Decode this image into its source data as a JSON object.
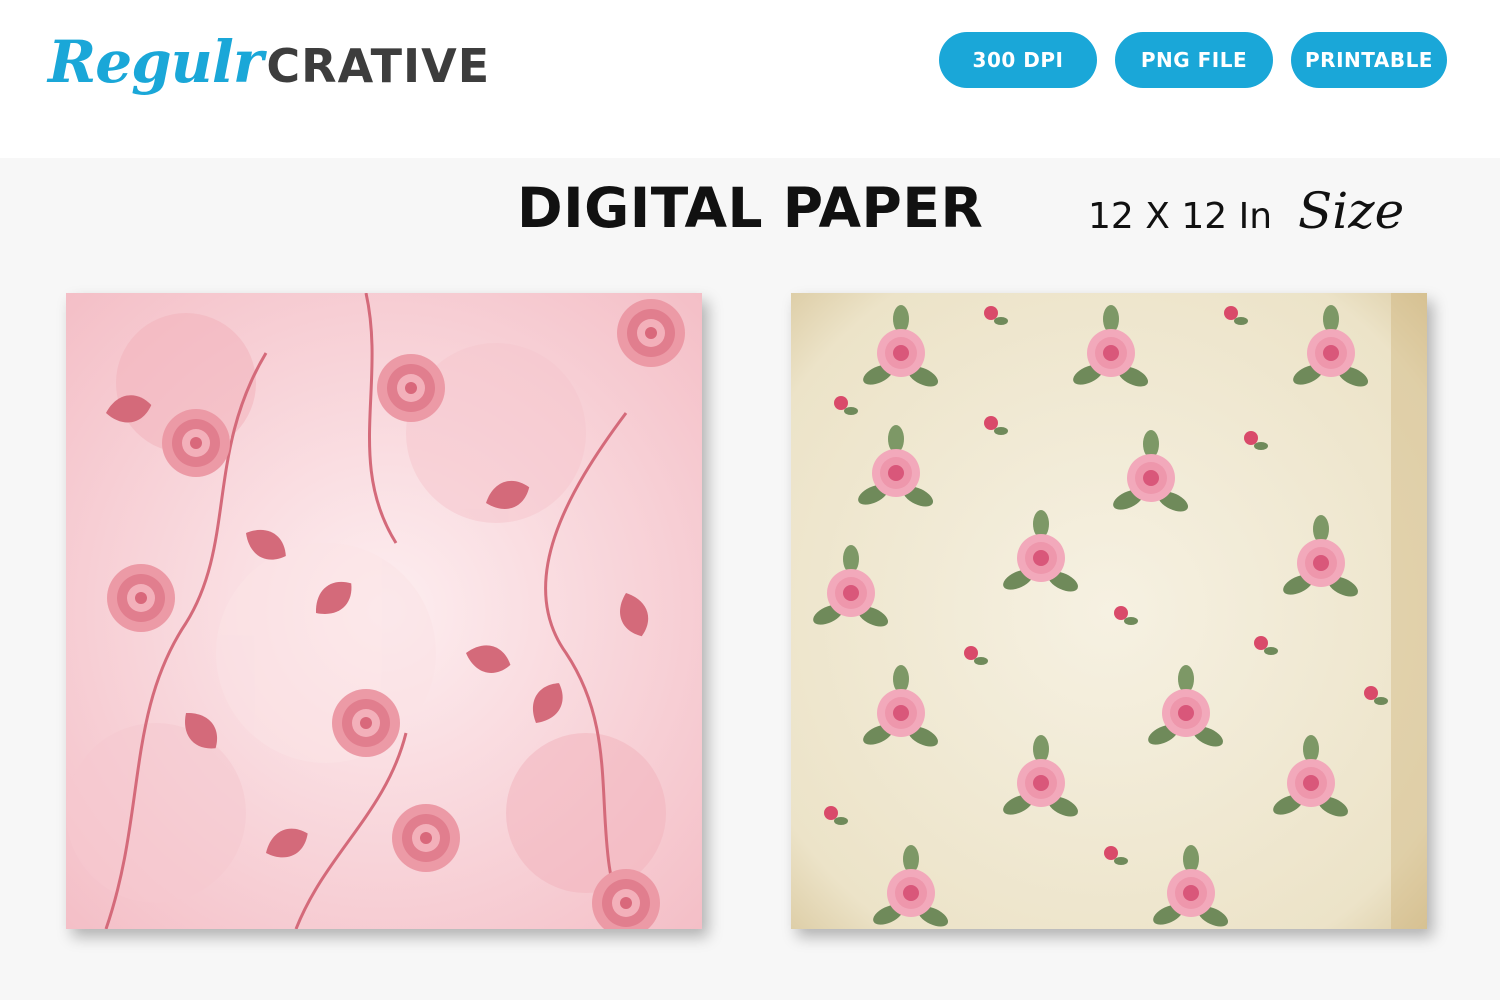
{
  "brand": {
    "script_part": "Regulr",
    "block_part": "CRATIVE",
    "script_color": "#1aa7d8",
    "block_color": "#3d3d3d"
  },
  "badges": [
    "300 DPI",
    "PNG FILE",
    "PRINTABLE"
  ],
  "badge_color": "#1aa7d8",
  "heading": {
    "title": "DIGITAL PAPER",
    "size_text": "12 X 12 In",
    "size_word": "Size"
  },
  "papers": [
    {
      "name": "pink-floral-paper",
      "background": "#f9d9de",
      "flower": "#e07b8a",
      "leaf": "#d46a7a"
    },
    {
      "name": "vintage-rose-paper",
      "background": "#f1ead6",
      "flower": "#ee9db0",
      "leaf": "#6f8a5a"
    }
  ]
}
